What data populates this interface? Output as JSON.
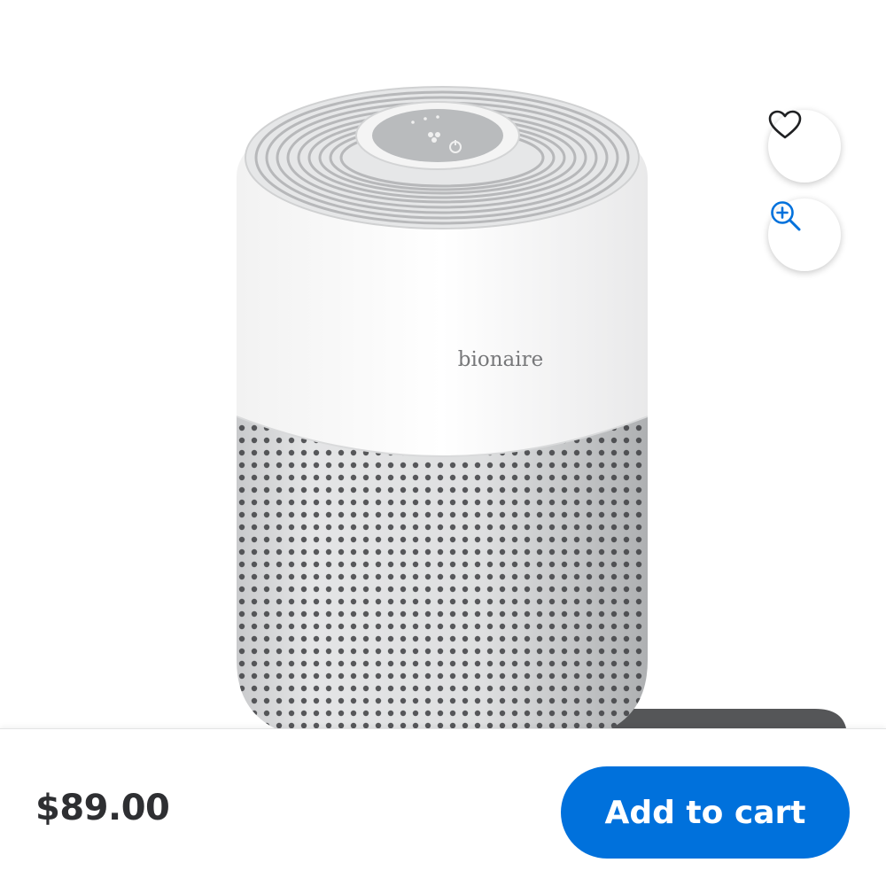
{
  "product": {
    "brand_print": "bionaire",
    "image_icon": "air-purifier-product-photo"
  },
  "actions": {
    "favorite_icon": "heart-outline-icon",
    "zoom_icon": "zoom-in-icon"
  },
  "purchase": {
    "price": "$89.00",
    "add_to_cart_label": "Add to cart"
  },
  "colors": {
    "accent": "#0071dc",
    "price_text": "#2e2f32",
    "icon_blue": "#0071dc"
  }
}
